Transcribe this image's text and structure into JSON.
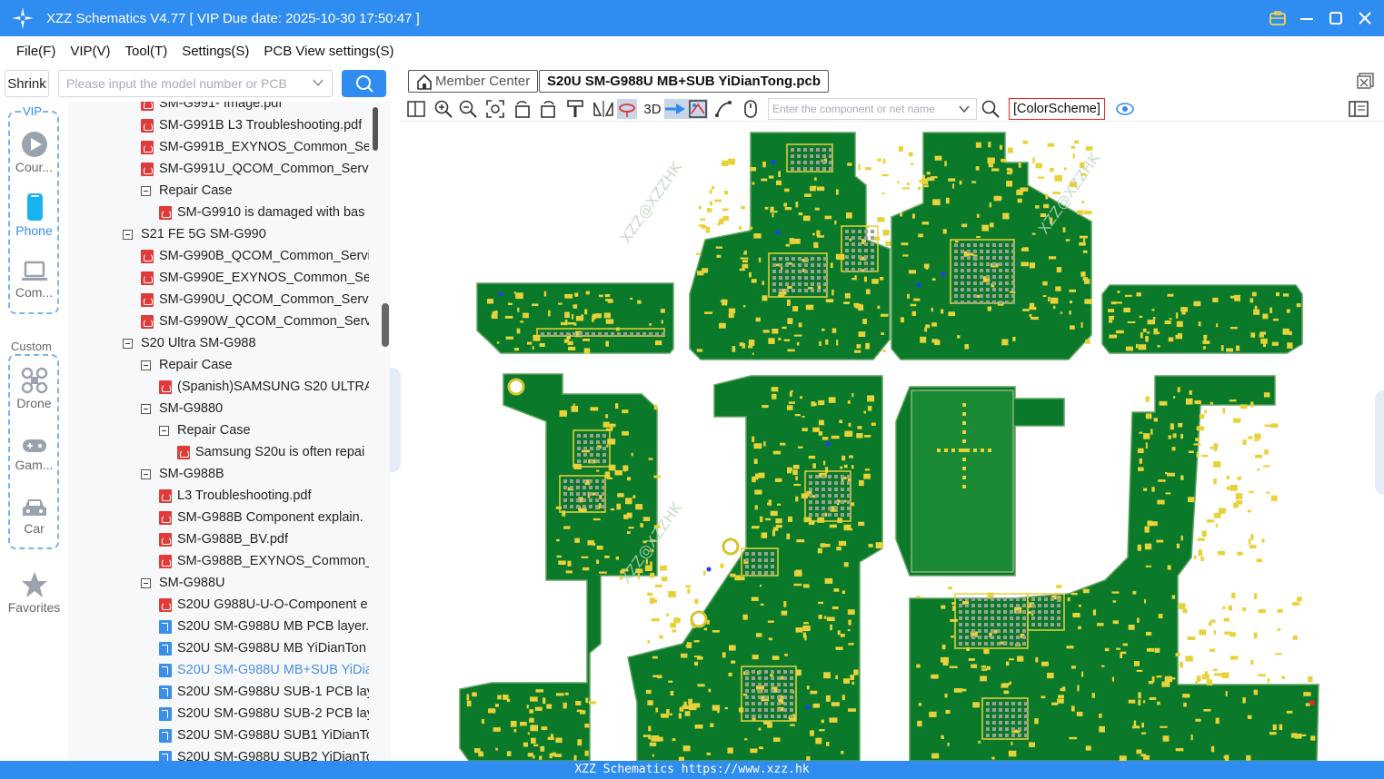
{
  "window": {
    "title": "XZZ Schematics V4.77 [ VIP Due date: 2025-10-30 17:50:47 ]",
    "icons": [
      "briefcase-icon",
      "minimize-icon",
      "maximize-icon",
      "close-icon"
    ]
  },
  "menu": [
    "File(F)",
    "VIP(V)",
    "Tool(T)",
    "Settings(S)",
    "PCB View settings(S)"
  ],
  "search": {
    "shrink_label": "Shrink",
    "placeholder": "Please input the model number or PCB"
  },
  "categories": {
    "vip_label": "VIP",
    "custom_label": "Custom",
    "items": [
      {
        "label": "Cour...",
        "icon": "play-icon"
      },
      {
        "label": "Phone",
        "icon": "phone-icon",
        "active": true
      },
      {
        "label": "Com...",
        "icon": "laptop-icon"
      },
      {
        "label": "Drone",
        "icon": "drone-icon"
      },
      {
        "label": "Gam...",
        "icon": "gamepad-icon"
      },
      {
        "label": "Car",
        "icon": "car-icon"
      },
      {
        "label": "Favorites",
        "icon": "star-icon"
      }
    ]
  },
  "tree": [
    {
      "label": "SM-G991- Image.pdf",
      "type": "pdf",
      "level": 2
    },
    {
      "label": "SM-G991B L3 Troubleshooting.pdf",
      "type": "pdf",
      "level": 2
    },
    {
      "label": "SM-G991B_EXYNOS_Common_Serv",
      "type": "pdf",
      "level": 2
    },
    {
      "label": "SM-G991U_QCOM_Common_Servi",
      "type": "pdf",
      "level": 2
    },
    {
      "label": "Repair Case",
      "type": "folder",
      "level": 2
    },
    {
      "label": "SM-G9910 is damaged with bas",
      "type": "pdf",
      "level": 3
    },
    {
      "label": "S21 FE 5G SM-G990",
      "type": "folder",
      "level": 1
    },
    {
      "label": "SM-G990B_QCOM_Common_Servic",
      "type": "pdf",
      "level": 2
    },
    {
      "label": "SM-G990E_EXYNOS_Common_Serv",
      "type": "pdf",
      "level": 2
    },
    {
      "label": "SM-G990U_QCOM_Common_Servi",
      "type": "pdf",
      "level": 2
    },
    {
      "label": "SM-G990W_QCOM_Common_Servi",
      "type": "pdf",
      "level": 2
    },
    {
      "label": "S20 Ultra SM-G988",
      "type": "folder",
      "level": 1
    },
    {
      "label": "Repair Case",
      "type": "folder",
      "level": 2
    },
    {
      "label": "(Spanish)SAMSUNG S20 ULTRA",
      "type": "pdf",
      "level": 3
    },
    {
      "label": "SM-G9880",
      "type": "folder",
      "level": 2
    },
    {
      "label": "Repair Case",
      "type": "folder",
      "level": 3
    },
    {
      "label": "Samsung S20u is often repai",
      "type": "pdf",
      "level": 4
    },
    {
      "label": "SM-G988B",
      "type": "folder",
      "level": 2
    },
    {
      "label": "L3 Troubleshooting.pdf",
      "type": "pdf",
      "level": 3
    },
    {
      "label": "SM-G988B Component explain.",
      "type": "pdf",
      "level": 3
    },
    {
      "label": "SM-G988B_BV.pdf",
      "type": "pdf",
      "level": 3
    },
    {
      "label": "SM-G988B_EXYNOS_Common_S",
      "type": "pdf",
      "level": 3
    },
    {
      "label": "SM-G988U",
      "type": "folder",
      "level": 2
    },
    {
      "label": "S20U G988U-U-O-Component e",
      "type": "pdf",
      "level": 3
    },
    {
      "label": "S20U SM-G988U MB PCB layer.p",
      "type": "pcb",
      "level": 3
    },
    {
      "label": "S20U SM-G988U MB YiDianTon",
      "type": "pcb",
      "level": 3
    },
    {
      "label": "S20U SM-G988U MB+SUB YiDia",
      "type": "pcb",
      "level": 3,
      "selected": true
    },
    {
      "label": "S20U SM-G988U SUB-1 PCB lay",
      "type": "pcb",
      "level": 3
    },
    {
      "label": "S20U SM-G988U SUB-2 PCB lay",
      "type": "pcb",
      "level": 3
    },
    {
      "label": "S20U SM-G988U SUB1 YiDianTo",
      "type": "pcb",
      "level": 3
    },
    {
      "label": "S20U SM-G988U SUB2 YiDianTo",
      "type": "pcb",
      "level": 3
    }
  ],
  "tabs": {
    "member": "Member Center",
    "active": "S20U SM-G988U MB+SUB YiDianTong.pcb"
  },
  "toolbar": {
    "three_d": "3D",
    "component_placeholder": "Enter the component or net name",
    "color_scheme": "[ColorScheme]"
  },
  "canvas": {
    "watermark": "XZZ@XZZHK",
    "board_color": "#0a7a2a",
    "pad_color": "#e8d23a"
  },
  "status": "XZZ Schematics https://www.xzz.hk"
}
